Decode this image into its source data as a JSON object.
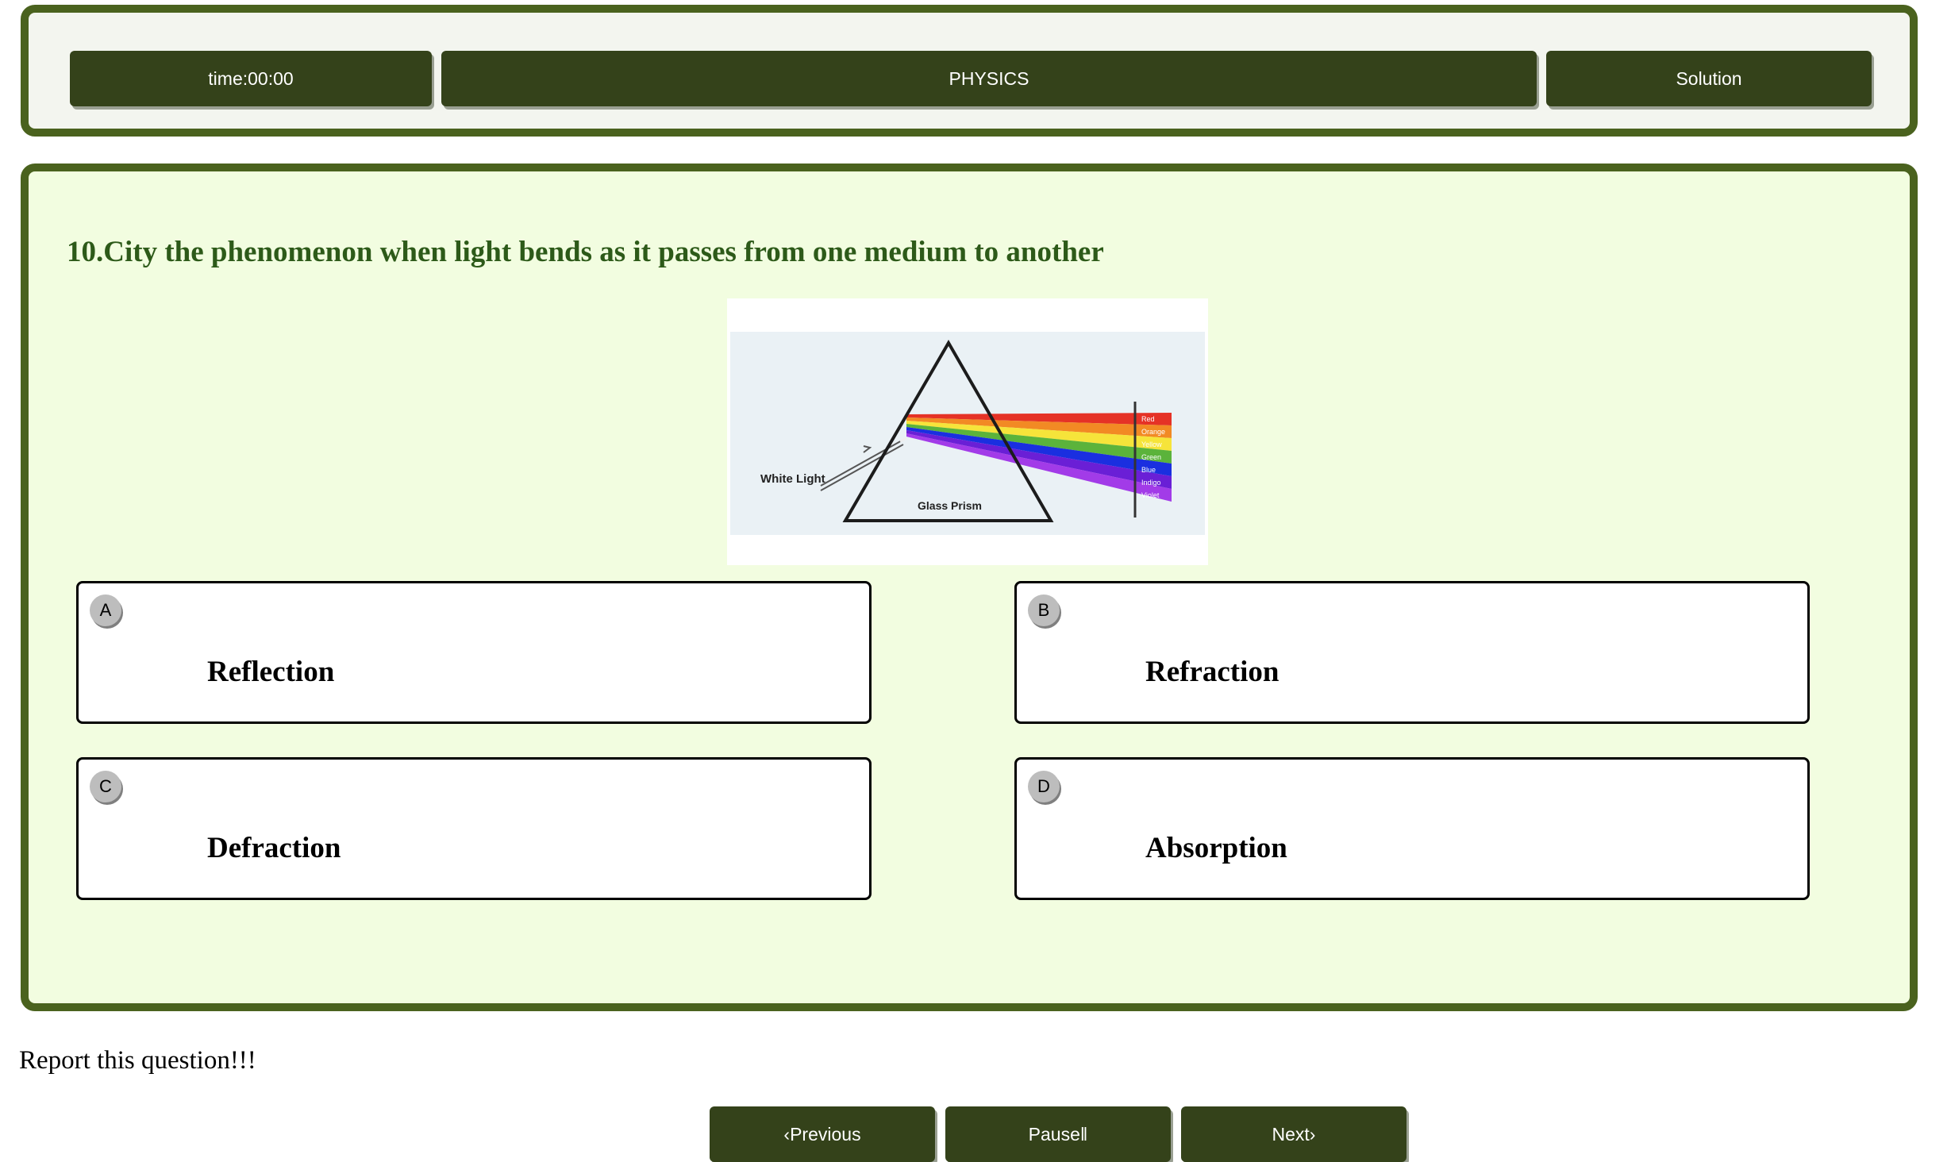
{
  "header": {
    "timer_label": "time:00:00",
    "subject_label": "PHYSICS",
    "solution_label": "Solution"
  },
  "question": {
    "text": "10.City the phenomenon when light bends as it passes from one medium to another"
  },
  "figure": {
    "white_light_label": "White Light",
    "prism_label": "Glass Prism",
    "spectrum": [
      {
        "name": "Red",
        "color": "#e53226"
      },
      {
        "name": "Orange",
        "color": "#f28a24"
      },
      {
        "name": "Yellow",
        "color": "#f6e43a"
      },
      {
        "name": "Green",
        "color": "#5bb33b"
      },
      {
        "name": "Blue",
        "color": "#1a2fe0"
      },
      {
        "name": "Indigo",
        "color": "#6a1fd6"
      },
      {
        "name": "Violet",
        "color": "#a23be8"
      }
    ]
  },
  "options": [
    {
      "letter": "A",
      "text": "Reflection"
    },
    {
      "letter": "B",
      "text": "Refraction"
    },
    {
      "letter": "C",
      "text": "Defraction"
    },
    {
      "letter": "D",
      "text": "Absorption"
    }
  ],
  "footer": {
    "report_label": "Report this question!!!",
    "previous_label": "‹Previous",
    "pause_label": "Pause‖",
    "next_label": "Next›"
  },
  "colors": {
    "frame_green": "#4a621e",
    "button_dark_green": "#34421a",
    "panel_background": "#f2fde0",
    "question_text": "#2d5a19"
  }
}
